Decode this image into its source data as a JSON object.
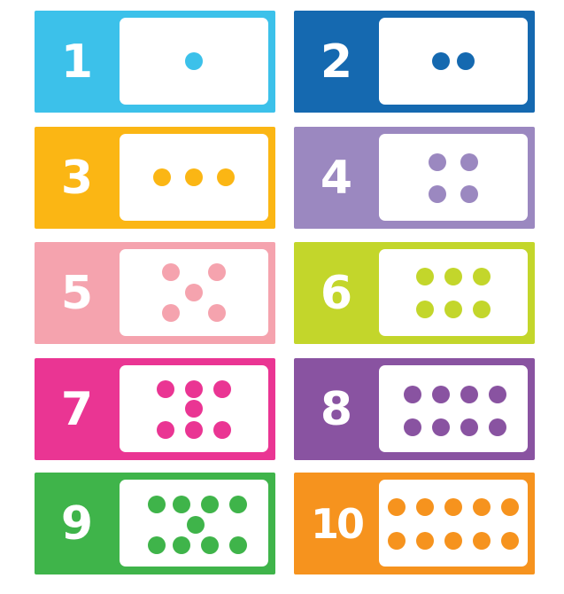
{
  "cards": [
    {
      "label": "1",
      "count": 1,
      "color": "#3cc1ea"
    },
    {
      "label": "2",
      "count": 2,
      "color": "#1569b0"
    },
    {
      "label": "3",
      "count": 3,
      "color": "#fbb614"
    },
    {
      "label": "4",
      "count": 4,
      "color": "#9b88c0"
    },
    {
      "label": "5",
      "count": 5,
      "color": "#f5a3ae"
    },
    {
      "label": "6",
      "count": 6,
      "color": "#c3d62b"
    },
    {
      "label": "7",
      "count": 7,
      "color": "#ea3593"
    },
    {
      "label": "8",
      "count": 8,
      "color": "#8953a1"
    },
    {
      "label": "9",
      "count": 9,
      "color": "#3fb44a"
    },
    {
      "label": "10",
      "count": 10,
      "color": "#f6931e"
    }
  ]
}
